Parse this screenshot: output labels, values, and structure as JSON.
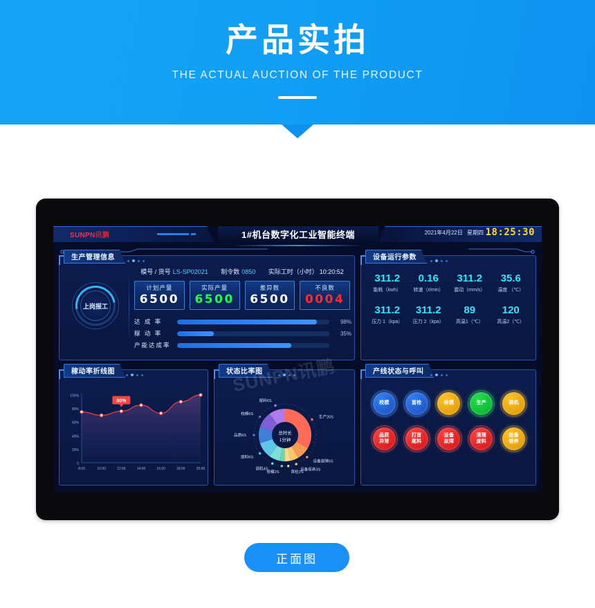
{
  "banner": {
    "title": "产品实拍",
    "subtitle": "THE ACTUAL AUCTION OF THE PRODUCT"
  },
  "bottom_button": {
    "label": "正面图"
  },
  "screen": {
    "brand": {
      "en": "SUNPN",
      "cn": "讯鹏"
    },
    "title": "1#机台数字化工业智能终端",
    "date": "2021年4月22日",
    "weekday": "星期四",
    "clock": "18:25:30",
    "watermark": "SUNPN讯鹏"
  },
  "production_panel": {
    "title": "生产管理信息",
    "gauge_label": "上岗报工",
    "info": [
      {
        "label": "模号 / 货号",
        "value": "LS-SP02021",
        "accent": true
      },
      {
        "label": "制令数",
        "value": "0850",
        "accent": true
      },
      {
        "label": "实际工时（小时）",
        "value": "10:20:52",
        "accent": false
      }
    ],
    "kpis": [
      {
        "label": "计划产量",
        "value": "6500",
        "color": "white"
      },
      {
        "label": "实际产量",
        "value": "6500",
        "color": "green"
      },
      {
        "label": "差异数",
        "value": "6500",
        "color": "white"
      },
      {
        "label": "不良数",
        "value": "0004",
        "color": "red"
      }
    ],
    "bars": [
      {
        "label": "达 成 率",
        "pct": "98%",
        "width": 92
      },
      {
        "label": "稼 动 率",
        "pct": "35%",
        "width": 24
      },
      {
        "label": "产能达成率",
        "pct": "",
        "width": 75
      }
    ]
  },
  "params_panel": {
    "title": "设备运行参数",
    "items": [
      {
        "value": "311.2",
        "label": "能耗（kwh）"
      },
      {
        "value": "0.16",
        "label": "转速（r/min）"
      },
      {
        "value": "311.2",
        "label": "震动（mm/s）"
      },
      {
        "value": "35.6",
        "label": "温度 （℃）"
      },
      {
        "value": "311.2",
        "label": "压力 1（kpa）"
      },
      {
        "value": "311.2",
        "label": "压力 2（kpa）"
      },
      {
        "value": "89",
        "label": "高温1（℃）"
      },
      {
        "value": "120",
        "label": "高温2（℃）"
      }
    ]
  },
  "status_panel": {
    "title": "产线状态与呼叫",
    "buttons": [
      {
        "label": "校模",
        "color": "blue"
      },
      {
        "label": "首检",
        "color": "blue"
      },
      {
        "label": "修模",
        "color": "amber"
      },
      {
        "label": "生产",
        "color": "green"
      },
      {
        "label": "调机",
        "color": "amber"
      },
      {
        "label": "品质异常",
        "color": "red"
      },
      {
        "label": "打首尾料",
        "color": "red"
      },
      {
        "label": "设备故障",
        "color": "red"
      },
      {
        "label": "清理废料",
        "color": "red"
      },
      {
        "label": "设备保养",
        "color": "amber"
      }
    ]
  },
  "chart_data": [
    {
      "type": "line",
      "title": "稼动率折线图",
      "xlabel": "",
      "ylabel": "",
      "x": [
        "8:00",
        "10:00",
        "12:00",
        "14:00",
        "16:00",
        "18:00",
        "20:00"
      ],
      "values": [
        75,
        70,
        76,
        85,
        73,
        90,
        100
      ],
      "ylim": [
        0,
        100
      ],
      "yticks": [
        "0",
        "20%",
        "40%",
        "60%",
        "80%",
        "100%"
      ],
      "annotation": {
        "label": "80%",
        "at_index": 2
      },
      "line_color": "#e8443c",
      "area_fill": "#5b3a7a",
      "grid": false,
      "legend": "none"
    },
    {
      "type": "pie",
      "title": "状态比率图",
      "center_label": "总时长",
      "center_value": "1分钟",
      "labels": [
        "生产20S",
        "设备故障5S",
        "设备保养3S",
        "首检2S",
        "修模2S",
        "调机4S",
        "废料6S",
        "品质6S",
        "校模6S",
        "尾料6S"
      ],
      "values": [
        20,
        5,
        3,
        2,
        2,
        4,
        6,
        6,
        6,
        6
      ],
      "colors": [
        "#fd6a58",
        "#f79a54",
        "#fbc76a",
        "#ffd98c",
        "#6fd6a8",
        "#7fe0d8",
        "#5ec8e8",
        "#3f7fd8",
        "#7e5fd8",
        "#b07ae8"
      ],
      "legend": "outside"
    }
  ]
}
